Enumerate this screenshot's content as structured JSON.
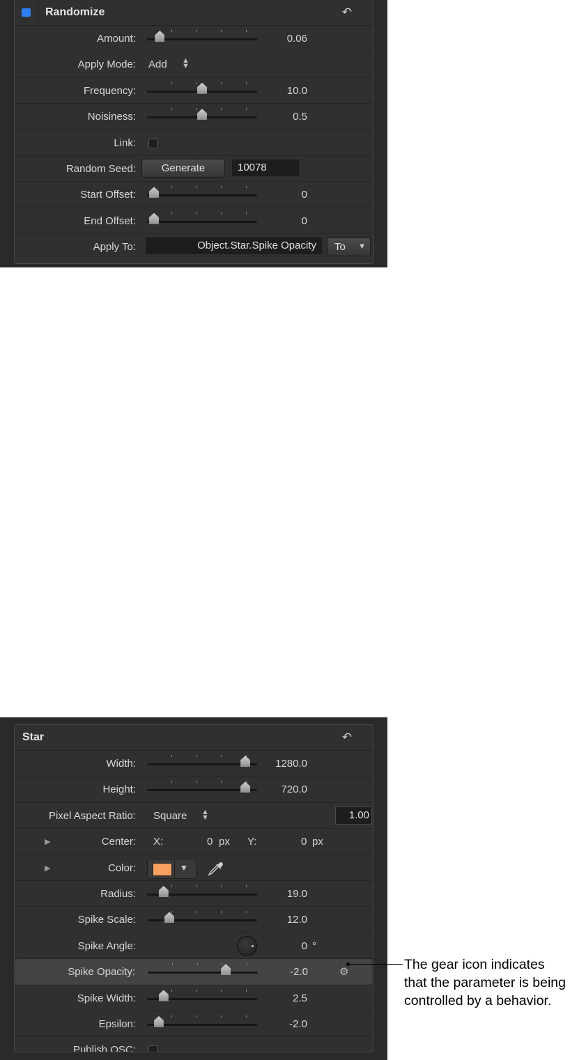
{
  "randomize": {
    "title": "Randomize",
    "enabled": true,
    "reset_icon": "undo-arrow-icon",
    "amount": {
      "label": "Amount:",
      "value": "0.06",
      "slider_fraction": 0.06
    },
    "apply_mode": {
      "label": "Apply Mode:",
      "value": "Add"
    },
    "frequency": {
      "label": "Frequency:",
      "value": "10.0",
      "slider_fraction": 0.5
    },
    "noisiness": {
      "label": "Noisiness:",
      "value": "0.5",
      "slider_fraction": 0.5
    },
    "link": {
      "label": "Link:",
      "checked": false
    },
    "random_seed": {
      "label": "Random Seed:",
      "button": "Generate",
      "value": "10078"
    },
    "start_offset": {
      "label": "Start Offset:",
      "value": "0",
      "slider_fraction": 0.0
    },
    "end_offset": {
      "label": "End Offset:",
      "value": "0",
      "slider_fraction": 0.0
    },
    "apply_to": {
      "label": "Apply To:",
      "value": "Object.Star.Spike Opacity",
      "dropdown": "To"
    }
  },
  "star": {
    "title": "Star",
    "reset_icon": "undo-arrow-icon",
    "width": {
      "label": "Width:",
      "value": "1280.0",
      "slider_fraction": 0.95
    },
    "height": {
      "label": "Height:",
      "value": "720.0",
      "slider_fraction": 0.95
    },
    "pixel_aspect_ratio": {
      "label": "Pixel Aspect Ratio:",
      "value": "Square",
      "field": "1.00"
    },
    "center": {
      "label": "Center:",
      "x_label": "X:",
      "x_value": "0",
      "y_label": "Y:",
      "y_value": "0",
      "unit": "px"
    },
    "color": {
      "label": "Color:",
      "swatch": "#f7a060"
    },
    "radius": {
      "label": "Radius:",
      "value": "19.0",
      "slider_fraction": 0.1
    },
    "spike_scale": {
      "label": "Spike Scale:",
      "value": "12.0",
      "slider_fraction": 0.16
    },
    "spike_angle": {
      "label": "Spike Angle:",
      "value": "0",
      "unit": "°"
    },
    "spike_opacity": {
      "label": "Spike Opacity:",
      "value": "-2.0",
      "slider_fraction": 0.74
    },
    "spike_width": {
      "label": "Spike Width:",
      "value": "2.5",
      "slider_fraction": 0.1
    },
    "epsilon": {
      "label": "Epsilon:",
      "value": "-2.0",
      "slider_fraction": 0.05
    },
    "publish_osc": {
      "label": "Publish OSC:",
      "checked": false
    }
  },
  "callout": {
    "line1": "The gear icon indicates",
    "line2": "that the parameter is being",
    "line3": "controlled by a behavior."
  }
}
